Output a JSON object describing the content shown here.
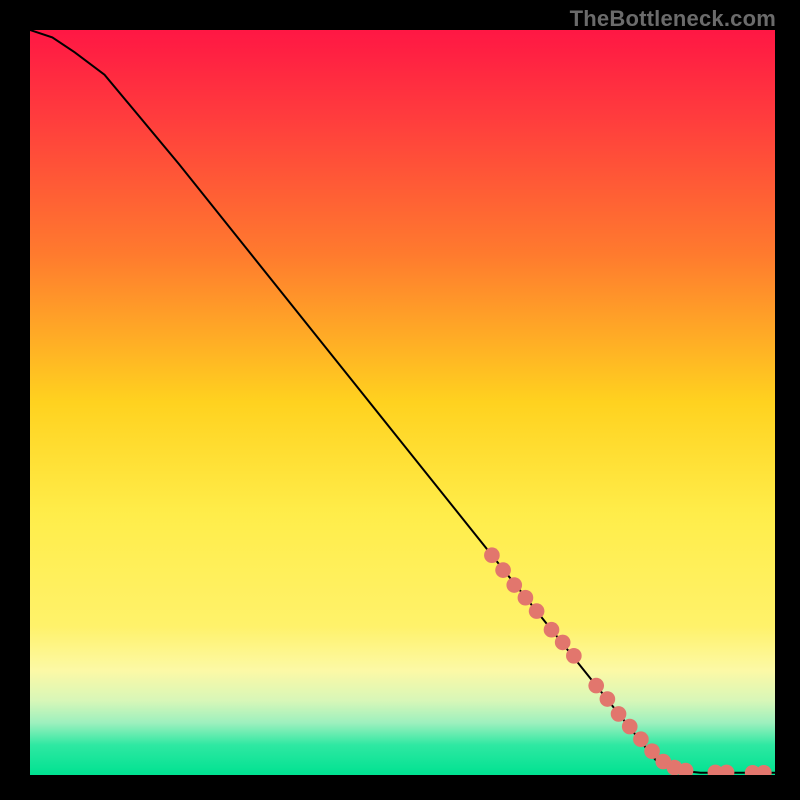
{
  "watermark": "TheBottleneck.com",
  "chart_data": {
    "type": "line",
    "title": "",
    "xlabel": "",
    "ylabel": "",
    "xlim": [
      0,
      100
    ],
    "ylim": [
      0,
      100
    ],
    "background_gradient": {
      "stops": [
        {
          "pct": 0,
          "color": "#ff1744"
        },
        {
          "pct": 12,
          "color": "#ff3d3d"
        },
        {
          "pct": 30,
          "color": "#ff7a2e"
        },
        {
          "pct": 50,
          "color": "#ffd21f"
        },
        {
          "pct": 65,
          "color": "#ffed4a"
        },
        {
          "pct": 80,
          "color": "#fff26a"
        },
        {
          "pct": 86,
          "color": "#fcf9a6"
        },
        {
          "pct": 90,
          "color": "#d8f7b8"
        },
        {
          "pct": 93,
          "color": "#9df0be"
        },
        {
          "pct": 96,
          "color": "#2ee8a2"
        },
        {
          "pct": 100,
          "color": "#00e291"
        }
      ]
    },
    "series": [
      {
        "name": "curve",
        "x": [
          0,
          3,
          6,
          10,
          15,
          20,
          30,
          40,
          50,
          60,
          70,
          80,
          84,
          88,
          90,
          100
        ],
        "y": [
          100,
          99,
          97,
          94,
          88,
          82,
          69.5,
          57,
          44.5,
          32,
          19.5,
          7,
          2,
          0.5,
          0.3,
          0.3
        ]
      }
    ],
    "marker_series": {
      "name": "markers",
      "color": "#e2766d",
      "x": [
        62,
        63.5,
        65,
        66.5,
        68,
        70,
        71.5,
        73,
        76,
        77.5,
        79,
        80.5,
        82,
        83.5,
        85,
        86.5,
        88,
        92,
        93.5,
        97,
        98.5
      ],
      "y": [
        29.5,
        27.5,
        25.5,
        23.8,
        22,
        19.5,
        17.8,
        16,
        12,
        10.2,
        8.2,
        6.5,
        4.8,
        3.2,
        1.8,
        1.0,
        0.6,
        0.35,
        0.35,
        0.3,
        0.3
      ]
    }
  }
}
